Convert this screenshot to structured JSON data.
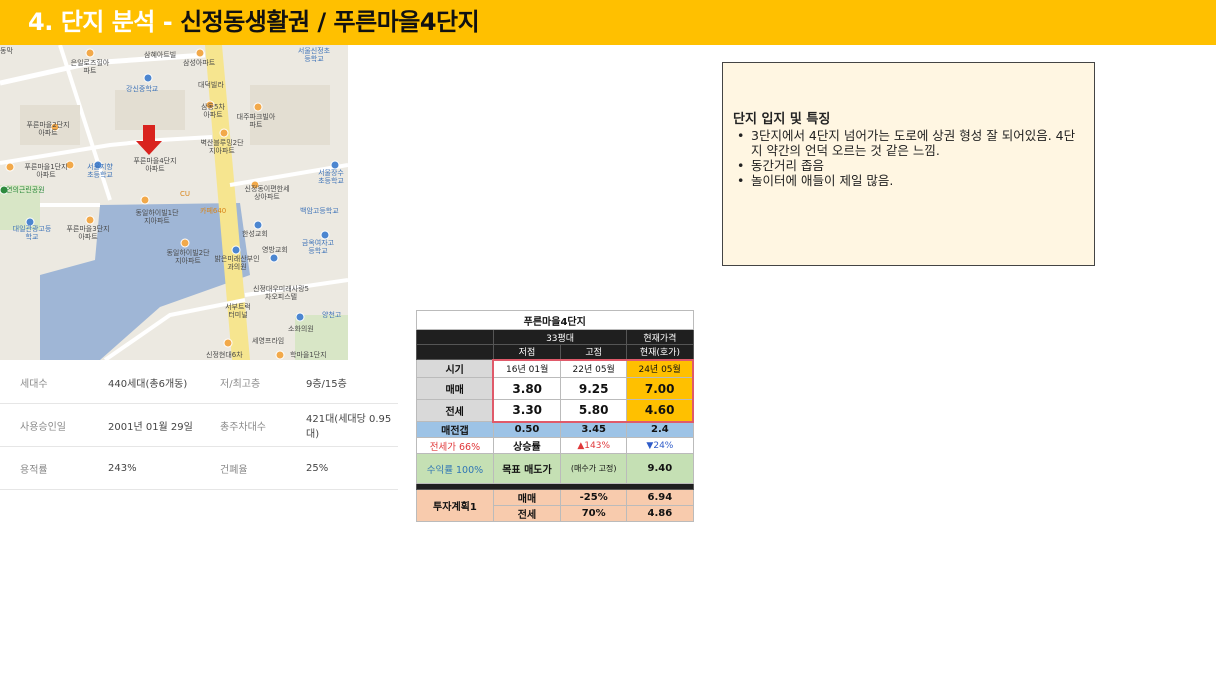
{
  "header": {
    "num": "4.",
    "section": "단지 분석",
    "dash": "-",
    "area": "신정동생활권",
    "slash": "/",
    "complex": "푸른마을4단지"
  },
  "map_labels": [
    "삼혜아트빌",
    "삼성아파트",
    "서울신정초등학교",
    "은일로즈힐아파트",
    "강신중학교",
    "대덕빌라",
    "삼동5차아파트",
    "대주파크빌아파트",
    "벽산블루밍2단지아파트",
    "푸른마을2단지아파트",
    "푸른마을1단지아파트",
    "서울지향초등학교",
    "푸른마을4단지아파트",
    "연의근린공원",
    "서울장수초등학교",
    "신정동이편한세상아파트",
    "백암고등학교",
    "동일하이빌1단지아파트",
    "카페640",
    "대일관광고등학교",
    "푸른마을3단지아파트",
    "한성교회",
    "영방교회",
    "금옥여자고등학교",
    "동일하이빌2단지아파트",
    "밝은미래산부인과의원",
    "신정대우미래사랑5차오피스텔",
    "서부트럭터미널",
    "양천고",
    "소화의원",
    "세영프라임",
    "신정현대6차",
    "학마을1단지",
    "CU",
    "동막"
  ],
  "info_table": [
    [
      "세대수",
      "440세대(총6개동)",
      "저/최고층",
      "9층/15층"
    ],
    [
      "사용승인일",
      "2001년 01월 29일",
      "총주차대수",
      "421대(세대당 0.95대)"
    ],
    [
      "용적률",
      "243%",
      "건폐율",
      "25%"
    ]
  ],
  "note": {
    "title": "단지 입지 및 특징",
    "items": [
      "3단지에서 4단지 넘어가는 도로에 상권 형성 잘 되어있음. 4단지 약간의 언덕 오르는 것 같은 느낌.",
      "동간거리 좁음",
      "놀이터에 애들이 제일 많음."
    ]
  },
  "price_table": {
    "title": "푸른마을4단지",
    "size": "33평대",
    "current_price": "현재가격",
    "low": "저점",
    "high": "고점",
    "now": "현재(호가)",
    "period_label": "시기",
    "period": [
      "16년 01월",
      "22년 05월",
      "24년 05월"
    ],
    "sale_label": "매매",
    "sale": [
      "3.80",
      "9.25",
      "7.00"
    ],
    "jeonse_label": "전세",
    "jeonse": [
      "3.30",
      "5.80",
      "4.60"
    ],
    "gap_label": "매전갭",
    "gap": [
      "0.50",
      "3.45",
      "2.4"
    ],
    "ratio_label": "전세가 66%",
    "rise_label": "상승률",
    "rise": [
      "▲143%",
      "▼24%"
    ],
    "yield_label": "수익률 100%",
    "target_label": "목표 매도가",
    "target_note": "(매수가 고정)",
    "target_value": "9.40",
    "plan_label": "투자계획1",
    "plan_sale_label": "매매",
    "plan_sale_pct": "-25%",
    "plan_sale_value": "6.94",
    "plan_jeonse_label": "전세",
    "plan_jeonse_pct": "70%",
    "plan_jeonse_value": "4.86"
  },
  "colors": {
    "title_bar": "#FFC000",
    "note_bg": "#FFF6E2",
    "gap_row": "#9DC3E6",
    "current_col": "#FFC000",
    "target_row": "#C5E0B4",
    "plan_row": "#F8CBAD",
    "highlight_border": "#E05A6A"
  }
}
